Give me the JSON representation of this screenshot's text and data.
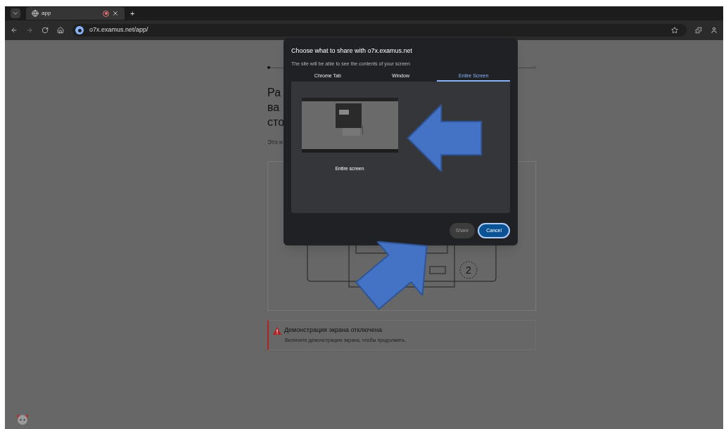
{
  "browser": {
    "tab": {
      "title": "app",
      "recording": true
    },
    "new_tab": "+",
    "url": "o7x.examus.net/app/"
  },
  "page": {
    "heading_lines": [
      "Ра",
      "ва",
      "сто"
    ],
    "intro": "Это н",
    "illustration": {
      "step_label": "2"
    },
    "alert": {
      "title": "Демонстрация экрана отключена",
      "message": "Включите демонстрацию экрана, чтобы продолжить."
    }
  },
  "dialog": {
    "title": "Choose what to share with o7x.examus.net",
    "subtitle": "The site will be able to see the contents of your screen",
    "tabs": [
      {
        "label": "Chrome Tab",
        "selected": false
      },
      {
        "label": "Window",
        "selected": false
      },
      {
        "label": "Entire Screen",
        "selected": true
      }
    ],
    "sources": [
      {
        "label": "Entire screen",
        "selected": false
      }
    ],
    "buttons": [
      {
        "label": "Share",
        "disabled": true
      },
      {
        "label": "Cancel",
        "disabled": false
      }
    ]
  }
}
